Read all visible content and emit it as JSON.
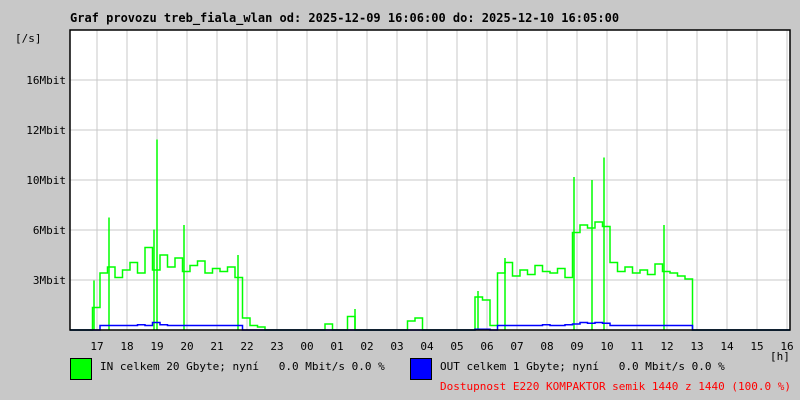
{
  "chart_data": {
    "type": "line",
    "title": "Graf provozu treb_fiala_wlan od: 2025-12-09 16:06:00 do: 2025-12-10 16:05:00",
    "ylabel": "[/s]",
    "xlabel": "[h]",
    "ylim": [
      0,
      20
    ],
    "y_unit": "Mbit/s",
    "y_ticks": [
      {
        "value": 3.33,
        "label": "3Mbit"
      },
      {
        "value": 6.67,
        "label": "6Mbit"
      },
      {
        "value": 10.0,
        "label": "10Mbit"
      },
      {
        "value": 13.33,
        "label": "12Mbit"
      },
      {
        "value": 16.67,
        "label": "16Mbit"
      }
    ],
    "x_start_hour": 16.1,
    "x_hours_span": 24,
    "x_ticks": [
      "17",
      "18",
      "19",
      "20",
      "21",
      "22",
      "23",
      "00",
      "01",
      "02",
      "03",
      "04",
      "05",
      "06",
      "07",
      "08",
      "09",
      "10",
      "11",
      "12",
      "13",
      "14",
      "15",
      "16"
    ],
    "grid": true,
    "sample_minutes": 15,
    "series": [
      {
        "name": "IN",
        "color": "#00ff00",
        "values": [
          0,
          0,
          0,
          1.5,
          3.8,
          4.2,
          3.5,
          4.0,
          4.5,
          3.8,
          5.5,
          4.0,
          5.0,
          4.2,
          4.8,
          3.9,
          4.3,
          4.6,
          3.8,
          4.1,
          3.9,
          4.2,
          3.5,
          0.8,
          0.3,
          0.2,
          0,
          0,
          0,
          0,
          0,
          0,
          0,
          0,
          0.4,
          0,
          0,
          0.9,
          0,
          0,
          0,
          0,
          0,
          0,
          0,
          0.6,
          0.8,
          0,
          0,
          0,
          0,
          0,
          0,
          0,
          2.2,
          2.0,
          0.3,
          3.8,
          4.5,
          3.6,
          4.0,
          3.7,
          4.3,
          3.9,
          3.8,
          4.1,
          3.5,
          6.5,
          7.0,
          6.8,
          7.2,
          6.9,
          4.5,
          3.9,
          4.2,
          3.8,
          4.0,
          3.7,
          4.4,
          3.9,
          3.8,
          3.6,
          3.4,
          0,
          0,
          0,
          0,
          0,
          0,
          0,
          0,
          0,
          0,
          0,
          0,
          0
        ],
        "spikes": [
          {
            "hour": 16.9,
            "value": 3.3
          },
          {
            "hour": 17.4,
            "value": 7.5
          },
          {
            "hour": 18.9,
            "value": 6.7
          },
          {
            "hour": 19.0,
            "value": 12.7
          },
          {
            "hour": 19.9,
            "value": 7.0
          },
          {
            "hour": 21.7,
            "value": 5.0
          },
          {
            "hour": 1.6,
            "value": 1.4
          },
          {
            "hour": 5.7,
            "value": 2.6
          },
          {
            "hour": 6.6,
            "value": 4.8
          },
          {
            "hour": 8.9,
            "value": 10.2
          },
          {
            "hour": 9.9,
            "value": 11.5
          },
          {
            "hour": 9.5,
            "value": 10.0
          },
          {
            "hour": 11.9,
            "value": 7.0
          }
        ]
      },
      {
        "name": "OUT",
        "color": "#0000ff",
        "values": [
          0,
          0,
          0,
          0,
          0.3,
          0.3,
          0.3,
          0.3,
          0.3,
          0.35,
          0.3,
          0.5,
          0.35,
          0.3,
          0.3,
          0.3,
          0.3,
          0.3,
          0.3,
          0.3,
          0.3,
          0.3,
          0.3,
          0,
          0,
          0,
          0,
          0,
          0,
          0,
          0,
          0,
          0,
          0,
          0,
          0,
          0,
          0,
          0,
          0,
          0,
          0,
          0,
          0,
          0,
          0,
          0,
          0,
          0,
          0,
          0,
          0,
          0,
          0,
          0.05,
          0.05,
          0,
          0.3,
          0.3,
          0.3,
          0.3,
          0.3,
          0.3,
          0.35,
          0.3,
          0.3,
          0.35,
          0.4,
          0.5,
          0.45,
          0.5,
          0.45,
          0.3,
          0.3,
          0.3,
          0.3,
          0.3,
          0.3,
          0.3,
          0.3,
          0.3,
          0.3,
          0.3,
          0,
          0,
          0,
          0,
          0,
          0,
          0,
          0,
          0,
          0,
          0,
          0,
          0
        ]
      }
    ]
  },
  "legend": {
    "in_text": "IN celkem 20 Gbyte; nyní   0.0 Mbit/s 0.0 %",
    "out_text": "OUT celkem 1 Gbyte; nyní   0.0 Mbit/s 0.0 %",
    "availability": "Dostupnost E220 KOMPAKTOR semik 1440 z 1440 (100.0 %)",
    "availability_color": "#ff0000"
  }
}
